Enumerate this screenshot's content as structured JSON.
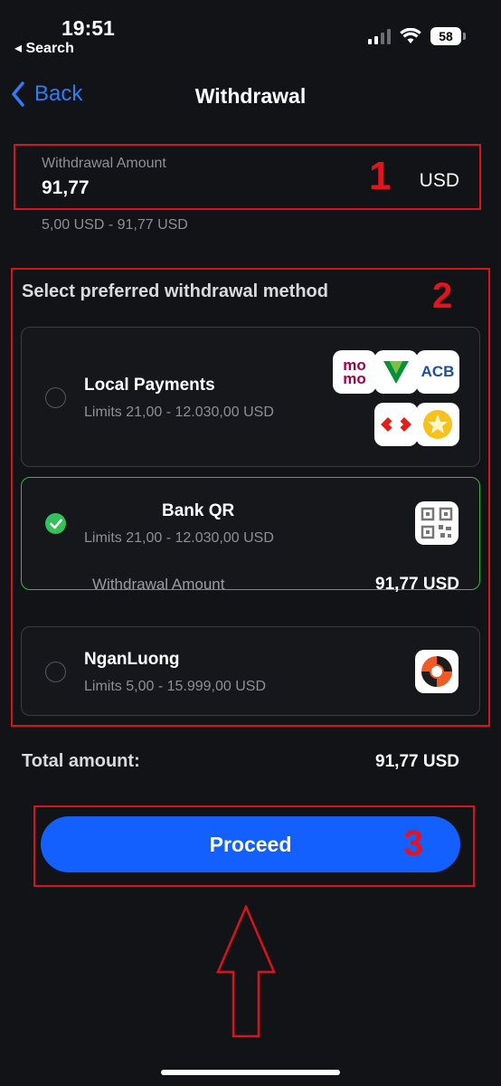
{
  "status_bar": {
    "time": "19:51",
    "back_app": "◂ Search",
    "battery": "58",
    "signal_icon": "signal-icon",
    "wifi_icon": "wifi-icon"
  },
  "nav": {
    "back_label": "Back",
    "title": "Withdrawal"
  },
  "amount": {
    "label": "Withdrawal Amount",
    "value": "91,77",
    "currency": "USD",
    "range": "5,00 USD - 91,77 USD"
  },
  "methods_section": {
    "title": "Select preferred withdrawal method",
    "methods": [
      {
        "name": "Local Payments",
        "limits": "Limits 21,00 - 12.030,00 USD",
        "selected": false,
        "logos": [
          {
            "icon": "momo-logo-icon",
            "text": "mo mo"
          },
          {
            "icon": "vietcombank-logo-icon"
          },
          {
            "icon": "acb-logo-icon",
            "text": "ACB"
          },
          {
            "icon": "techcombank-logo-icon"
          },
          {
            "icon": "sacombank-logo-icon"
          }
        ]
      },
      {
        "name": "Bank QR",
        "limits": "Limits 21,00 - 12.030,00 USD",
        "selected": true,
        "detail_label": "Withdrawal Amount",
        "detail_value": "91,77 USD",
        "logos": [
          {
            "icon": "qr-code-icon"
          }
        ]
      },
      {
        "name": "NganLuong",
        "limits": "Limits 5,00 - 15.999,00 USD",
        "selected": false,
        "logos": [
          {
            "icon": "nganluong-logo-icon"
          }
        ]
      }
    ]
  },
  "total": {
    "label": "Total amount:",
    "value": "91,77 USD"
  },
  "proceed_label": "Proceed",
  "annotations": {
    "n1": "1",
    "n2": "2",
    "n3": "3",
    "color": "#d7141d"
  },
  "colors": {
    "accent_blue": "#1460ff",
    "link_blue": "#2f7cf6",
    "success_green": "#34c05a",
    "background": "#121316"
  }
}
